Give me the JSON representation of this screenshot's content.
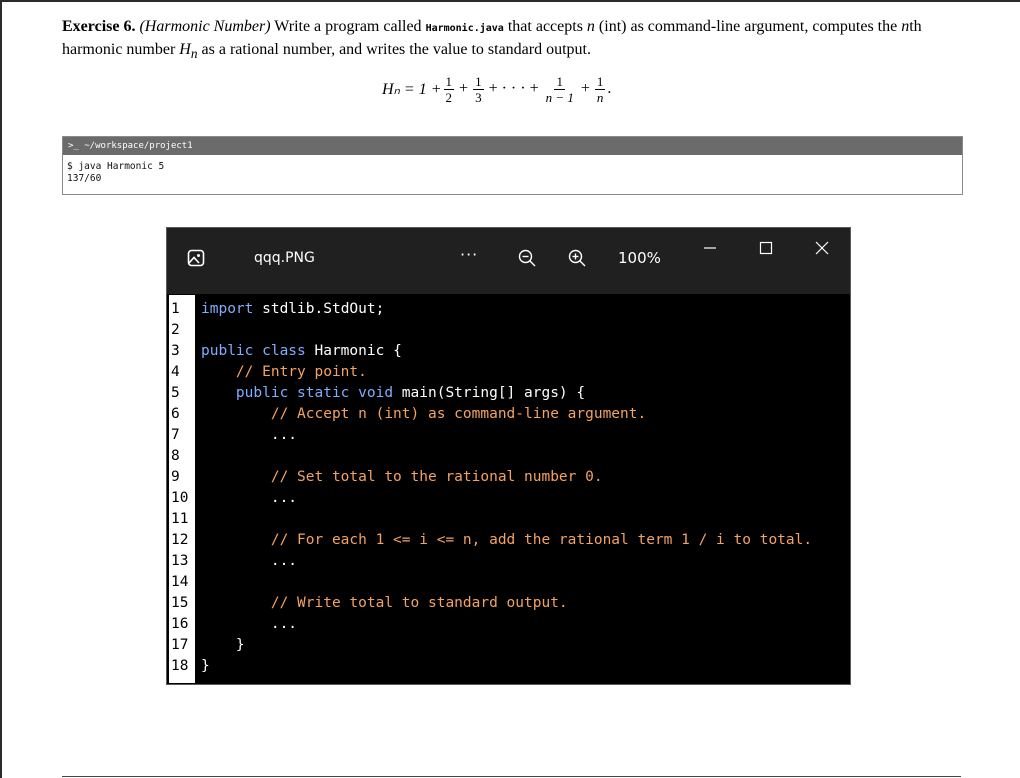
{
  "exercise": {
    "label": "Exercise 6.",
    "title": "(Harmonic Number)",
    "text_1": " Write a program called ",
    "filename": "Harmonic.java",
    "text_2": " that accepts ",
    "var_n": "n",
    "text_3": " (int) as command-line argument, computes the ",
    "var_nth": "n",
    "text_4": "th harmonic number ",
    "var_hn": "H",
    "var_hn_sub": "n",
    "text_5": " as a rational number, and writes the value to standard output."
  },
  "formula": {
    "lhs": "Hₙ = 1 +",
    "terms": [
      {
        "num": "1",
        "den": "2"
      },
      {
        "num": "1",
        "den": "3"
      }
    ],
    "middle": "+ · · · +",
    "term_n1": {
      "num": "1",
      "den": "n − 1"
    },
    "term_n": {
      "num": "1",
      "den": "n"
    },
    "end": "."
  },
  "terminal": {
    "prompt_icon": ">_",
    "path": "~/workspace/project1",
    "command": "$ java Harmonic 5",
    "output": "137/60"
  },
  "viewer": {
    "filename": "qqq.PNG",
    "more": "···",
    "zoom": "100%",
    "icons": [
      "photos-app-icon",
      "zoom-out-icon",
      "zoom-in-icon",
      "minimize-icon",
      "maximize-icon",
      "close-icon"
    ]
  },
  "code": {
    "line_numbers": [
      "1",
      "2",
      "3",
      "4",
      "5",
      "6",
      "7",
      "8",
      "9",
      "10",
      "11",
      "12",
      "13",
      "14",
      "15",
      "16",
      "17",
      "18"
    ],
    "lines": [
      {
        "indent": "",
        "kw": "import",
        "rest": " stdlib.StdOut;",
        "type": "import"
      },
      {
        "indent": "",
        "text": "",
        "type": "blank"
      },
      {
        "indent": "",
        "kw": "public class",
        "rest": " Harmonic {",
        "type": "class"
      },
      {
        "indent": "    ",
        "text": "// Entry point.",
        "type": "comment"
      },
      {
        "indent": "    ",
        "kw": "public static void",
        "rest": " main(String[] args) {",
        "type": "method"
      },
      {
        "indent": "        ",
        "text": "// Accept n (int) as command-line argument.",
        "type": "comment"
      },
      {
        "indent": "        ",
        "text": "...",
        "type": "plain"
      },
      {
        "indent": "",
        "text": "",
        "type": "blank"
      },
      {
        "indent": "        ",
        "text": "// Set total to the rational number 0.",
        "type": "comment"
      },
      {
        "indent": "        ",
        "text": "...",
        "type": "plain"
      },
      {
        "indent": "",
        "text": "",
        "type": "blank"
      },
      {
        "indent": "        ",
        "text": "// For each 1 <= i <= n, add the rational term 1 / i to total.",
        "type": "comment"
      },
      {
        "indent": "        ",
        "text": "...",
        "type": "plain"
      },
      {
        "indent": "",
        "text": "",
        "type": "blank"
      },
      {
        "indent": "        ",
        "text": "// Write total to standard output.",
        "type": "comment"
      },
      {
        "indent": "        ",
        "text": "...",
        "type": "plain"
      },
      {
        "indent": "    ",
        "text": "}",
        "type": "plain"
      },
      {
        "indent": "",
        "text": "}",
        "type": "plain"
      }
    ]
  },
  "colors": {
    "keyword": "#c792ea",
    "comment": "#f4a261",
    "viewer_bg": "#202020"
  }
}
